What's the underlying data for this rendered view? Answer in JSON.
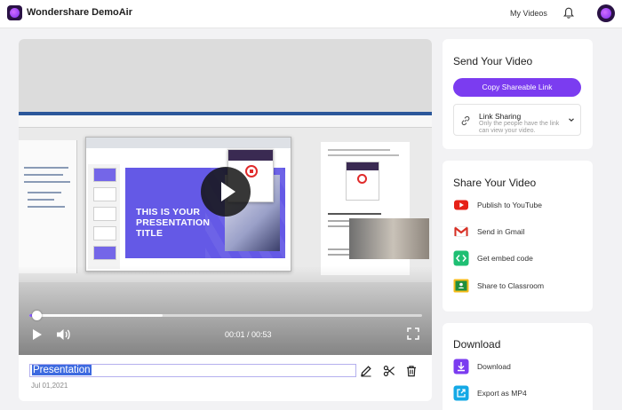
{
  "app": {
    "title": "Wondershare DemoAir"
  },
  "nav": {
    "my_videos": "My Videos"
  },
  "video": {
    "title": "Presentation",
    "date": "Jul 01,2021",
    "time_display": "00:01 / 00:53",
    "progress_fraction": 0.019,
    "buffered_fraction": 0.34,
    "slide_title": "THIS IS YOUR PRESENTATION TITLE"
  },
  "send": {
    "heading": "Send Your Video",
    "copy_button": "Copy Shareable Link",
    "link_sharing_title": "Link Sharing",
    "link_sharing_desc": "Only the people have the link can view your video."
  },
  "share": {
    "heading": "Share Your Video",
    "items": [
      {
        "label": "Publish to YouTube",
        "icon": "youtube-icon"
      },
      {
        "label": "Send in Gmail",
        "icon": "gmail-icon"
      },
      {
        "label": "Get embed code",
        "icon": "embed-code-icon"
      },
      {
        "label": "Share to Classroom",
        "icon": "google-classroom-icon"
      }
    ]
  },
  "download": {
    "heading": "Download",
    "items": [
      {
        "label": "Download",
        "icon": "download-icon"
      },
      {
        "label": "Export as MP4",
        "icon": "export-icon"
      }
    ]
  },
  "colors": {
    "accent": "#7b3cf0",
    "youtube": "#e62117",
    "embed": "#1fbf73",
    "classroom": "#1e8e3e"
  }
}
